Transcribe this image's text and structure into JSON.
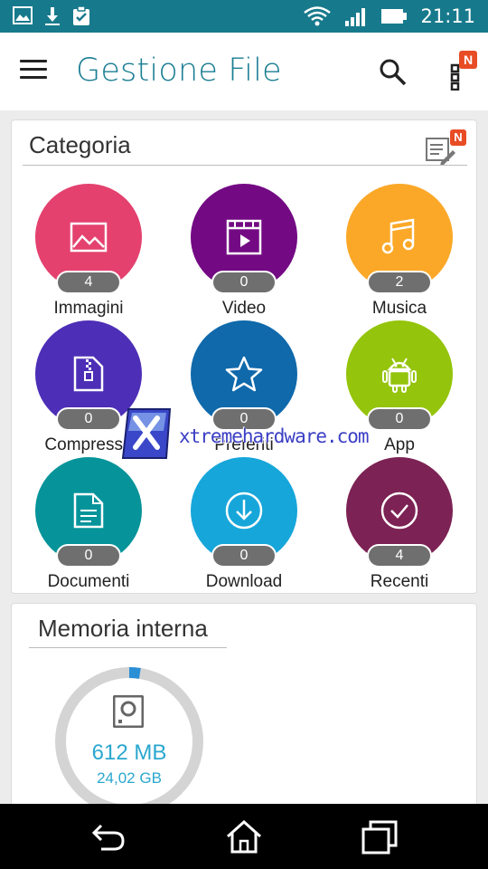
{
  "status_bar": {
    "time": "21:11",
    "left_icons": [
      "gallery-icon",
      "download-icon",
      "clipboard-check-icon"
    ],
    "right_icons": [
      "wifi-icon",
      "signal-icon",
      "battery-icon"
    ]
  },
  "appbar": {
    "title": "Gestione File",
    "more_badge": "N",
    "icons": [
      "menu-icon",
      "search-icon",
      "more-icon"
    ]
  },
  "category": {
    "title": "Categoria",
    "note_badge": "N",
    "items": [
      {
        "label": "Immagini",
        "count": "4",
        "color": "#e4416f",
        "icon": "image-icon"
      },
      {
        "label": "Video",
        "count": "0",
        "color": "#730a83",
        "icon": "video-icon"
      },
      {
        "label": "Musica",
        "count": "2",
        "color": "#fba828",
        "icon": "music-icon"
      },
      {
        "label": "Compresso",
        "count": "0",
        "color": "#4d2eb6",
        "icon": "zip-file-icon"
      },
      {
        "label": "Preferiti",
        "count": "0",
        "color": "#0f69ab",
        "icon": "star-icon"
      },
      {
        "label": "App",
        "count": "0",
        "color": "#94c40b",
        "icon": "android-icon"
      },
      {
        "label": "Documenti",
        "count": "0",
        "color": "#06949a",
        "icon": "document-icon"
      },
      {
        "label": "Download",
        "count": "0",
        "color": "#16a6da",
        "icon": "download-circle-icon"
      },
      {
        "label": "Recenti",
        "count": "4",
        "color": "#7c2254",
        "icon": "check-circle-icon"
      }
    ]
  },
  "memory": {
    "title": "Memoria interna",
    "used": "612 MB",
    "total": "24,02 GB",
    "used_fraction": 0.025,
    "ring_color": "#d4d4d4",
    "used_color": "#2b8fd6",
    "icon": "hard-drive-icon"
  },
  "watermark": {
    "text": "xtremehardware.com"
  },
  "navbar": {
    "icons": [
      "back-icon",
      "home-icon",
      "recents-icon"
    ]
  }
}
